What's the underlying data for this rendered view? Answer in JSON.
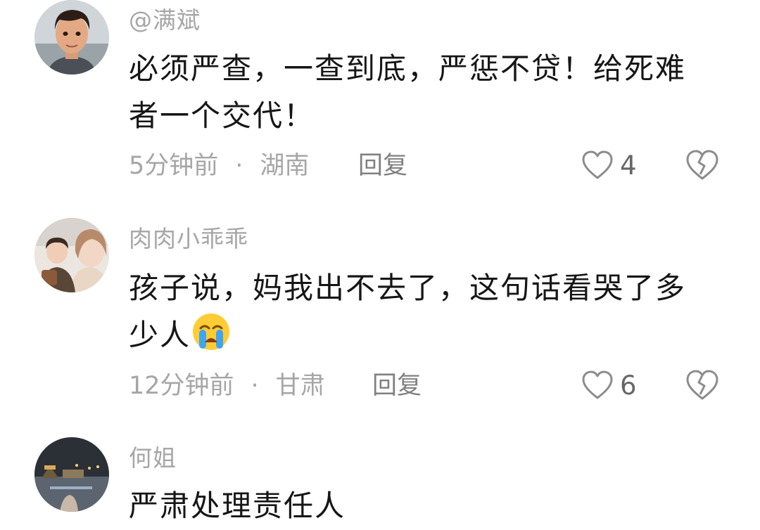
{
  "comments": [
    {
      "username": "@满斌",
      "text": "必须严查，一查到底，严惩不贷！给死难者一个交代！",
      "time": "5分钟前",
      "location": "湖南",
      "reply_label": "回复",
      "likes": "4",
      "avatar_icon": "cartoon-man-avatar"
    },
    {
      "username": "肉肉小乖乖",
      "text": "孩子说，妈我出不去了，这句话看哭了多少人",
      "emoji": "loudly-crying-face-icon",
      "time": "12分钟前",
      "location": "甘肃",
      "reply_label": "回复",
      "likes": "6",
      "avatar_icon": "mother-and-child-photo-avatar"
    },
    {
      "username": "何姐",
      "text": "严肃处理责任人",
      "avatar_icon": "night-city-photo-avatar"
    }
  ],
  "separator": "·",
  "colors": {
    "meta_gray": "#a6a6a6",
    "text": "#161616",
    "icon_gray": "#8c8c8c"
  }
}
